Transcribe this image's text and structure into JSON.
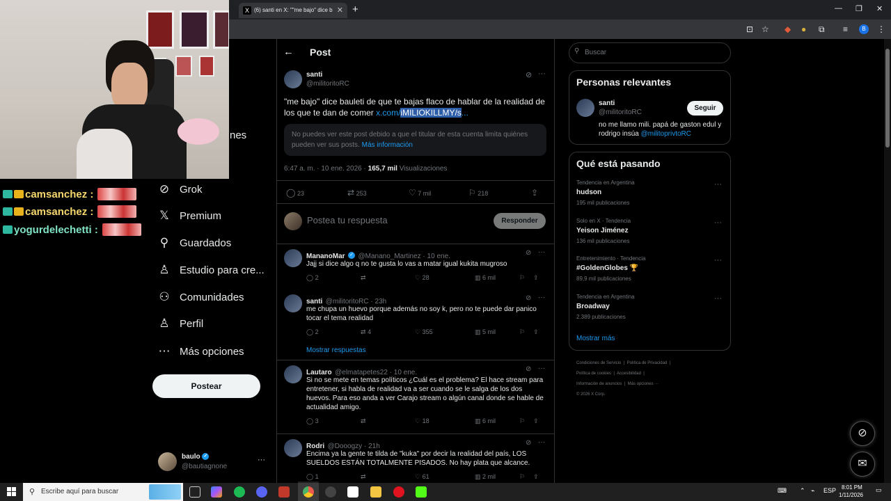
{
  "browser": {
    "tab_title": "(6) santi en X: \"\"me bajo\" dice b",
    "tab_close": "✕",
    "new_tab": "+",
    "win_min": "—",
    "win_max": "❐",
    "win_close": "✕",
    "profile_initial": "B"
  },
  "overlay": {
    "chat": [
      {
        "user": "camsanchez :",
        "color": "#f5d76e"
      },
      {
        "user": "camsanchez :",
        "color": "#f5d76e"
      },
      {
        "user": "yogurdelechetti :",
        "color": "#7fe3c6"
      }
    ],
    "partial_nav_label": "nes"
  },
  "nav": {
    "items": [
      {
        "label": "Grok",
        "icon": "grok-icon",
        "glyph": "⊘"
      },
      {
        "label": "Premium",
        "icon": "x-logo-icon",
        "glyph": "𝕏"
      },
      {
        "label": "Guardados",
        "icon": "bookmark-icon",
        "glyph": "⚲"
      },
      {
        "label": "Estudio para cre...",
        "icon": "creator-studio-icon",
        "glyph": "♙"
      },
      {
        "label": "Comunidades",
        "icon": "communities-icon",
        "glyph": "⚇"
      },
      {
        "label": "Perfil",
        "icon": "profile-icon",
        "glyph": "♙"
      },
      {
        "label": "Más opciones",
        "icon": "more-circle-icon",
        "glyph": "⋯"
      }
    ],
    "post_button": "Postear",
    "account": {
      "name": "baulo",
      "handle": "@bautiagnone",
      "more": "···"
    }
  },
  "main": {
    "back": "←",
    "title": "Post",
    "tweet": {
      "name": "santi",
      "handle": "@militoritoRC",
      "text": "\"me bajo\" dice bauleti de que te bajas flaco de hablar de la realidad de los que te dan de comer",
      "link_prefix": "x.com/",
      "link_highlight": "iMILIOKILLMY/s",
      "link_suffix": "...",
      "notice": "No puedes ver este post debido a que el titular de esta cuenta limita quiénes pueden ver sus posts.",
      "notice_link": "Más información",
      "time": "6:47 a. m. · 10 ene. 2026 ·",
      "views_count": "165,7 mil",
      "views_label": "Visualizaciones",
      "replies": "23",
      "reposts": "253",
      "likes": "7 mil",
      "bookmarks": "218"
    },
    "reply_box": {
      "placeholder": "Postea tu respuesta",
      "button": "Responder"
    },
    "replies": [
      {
        "name": "MananoMar",
        "verified": true,
        "handle": "@Manano_Martinez · 10 ene.",
        "text": "Jajj si dice algo q no te gusta lo vas a matar igual kukita mugroso",
        "replies": "2",
        "reposts": "",
        "likes": "28",
        "views": "6 mil"
      },
      {
        "name": "santi",
        "verified": false,
        "handle": "@militoritoRC · 23h",
        "text": "me chupa un huevo porque además no soy k, pero no te puede dar panico tocar el tema realidad",
        "replies": "2",
        "reposts": "4",
        "likes": "355",
        "views": "5 mil"
      },
      {
        "name": "Lautaro",
        "verified": false,
        "handle": "@elmatapetes22 · 10 ene.",
        "text": "Si no se mete en temas políticos ¿Cuál es el problema? El hace stream para entretener, si habla de realidad va a ser cuando se le salga de los dos huevos. Para eso anda a ver Carajo stream o algún canal donde se hable de actualidad amigo.",
        "replies": "3",
        "reposts": "",
        "likes": "18",
        "views": "6 mil"
      },
      {
        "name": "Rodri",
        "verified": false,
        "handle": "@Dooogzy · 21h",
        "text": "Encima ya la gente te tilda de \"kuka\" por decir la realidad del país, LOS SUELDOS ESTÁN TOTALMENTE PISADOS. No hay plata que alcance.",
        "replies": "1",
        "reposts": "",
        "likes": "61",
        "views": "2 mil"
      }
    ],
    "show_more_replies": "Mostrar respuestas"
  },
  "right": {
    "search_placeholder": "Buscar",
    "relevant": {
      "title": "Personas relevantes",
      "name": "santi",
      "handle": "@militoritoRC",
      "follow": "Seguir",
      "bio": "no me llamo mili. papá de gaston edul y rodrigo insúa",
      "bio_link": "@militoprivtoRC"
    },
    "trends": {
      "title": "Qué está pasando",
      "items": [
        {
          "category": "Tendencia en Argentina",
          "name": "hudson",
          "count": "195 mil publicaciones"
        },
        {
          "category": "Solo en X · Tendencia",
          "name": "Yeison Jiménez",
          "count": "136 mil publicaciones"
        },
        {
          "category": "Entretenimiento · Tendencia",
          "name": "#GoldenGlobes 🏆",
          "count": "89,9 mil publicaciones"
        },
        {
          "category": "Tendencia en Argentina",
          "name": "Broadway",
          "count": "2.389 publicaciones"
        }
      ],
      "show_more": "Mostrar más"
    },
    "footer": {
      "line1a": "Condiciones de Servicio",
      "line1b": "Política de Privacidad",
      "line2a": "Política de cookies",
      "line2b": "Accesibilidad",
      "line3a": "Información de anuncios",
      "line3b": "Más opciones ···",
      "copyright": "© 2026 X Corp."
    }
  },
  "taskbar": {
    "search_placeholder": "Escribe aquí para buscar",
    "lang": "ESP",
    "time": "8:01 PM",
    "date": "1/11/2026"
  }
}
